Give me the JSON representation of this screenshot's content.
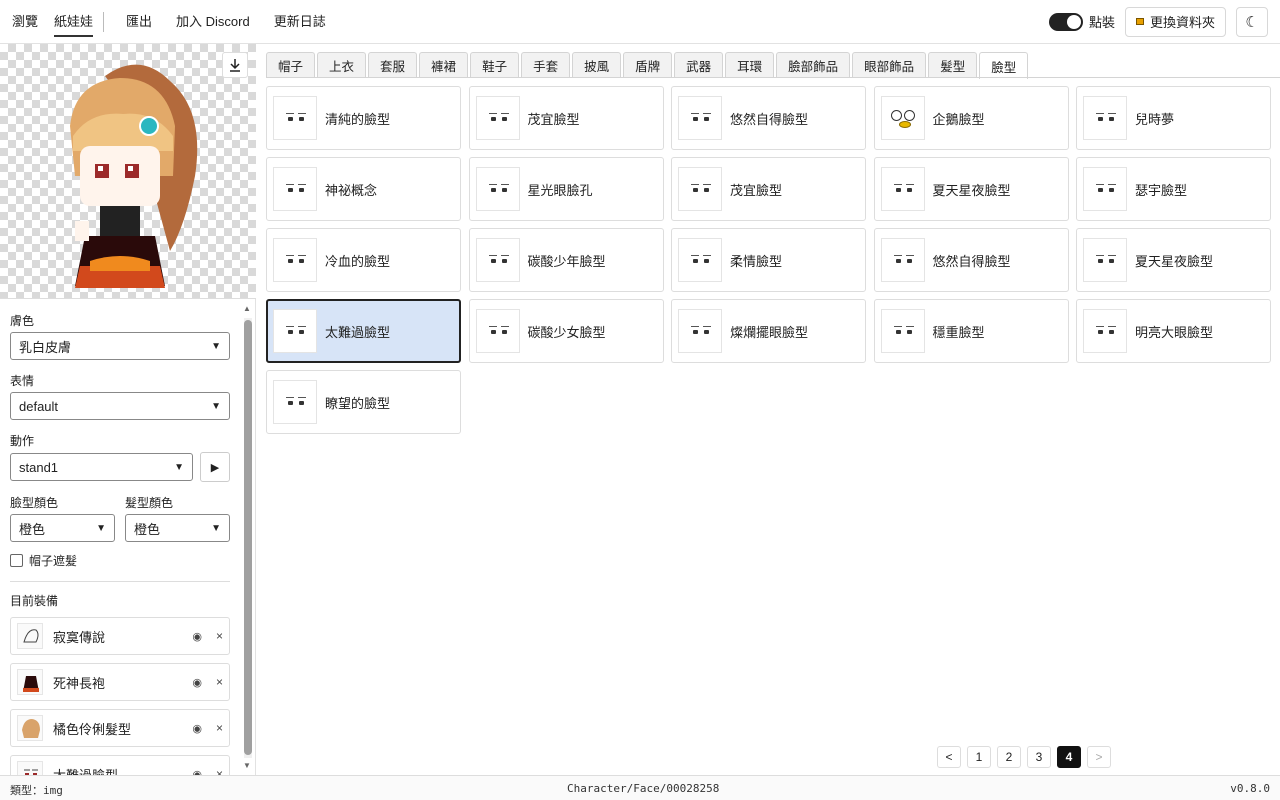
{
  "nav": {
    "browse": "瀏覽",
    "paperdoll": "紙娃娃",
    "export": "匯出",
    "discord": "加入 Discord",
    "changelog": "更新日誌",
    "cash_label": "點裝",
    "change_folder": "更換資料夾",
    "theme_glyph": "☾"
  },
  "settings": {
    "skin_label": "膚色",
    "skin_value": "乳白皮膚",
    "expression_label": "表情",
    "expression_value": "default",
    "action_label": "動作",
    "action_value": "stand1",
    "face_color_label": "臉型顏色",
    "face_color_value": "橙色",
    "hair_color_label": "髮型顏色",
    "hair_color_value": "橙色",
    "hat_hair_label": "帽子遮髮",
    "equipped_title": "目前裝備"
  },
  "equipped": [
    {
      "name": "寂寞傳說"
    },
    {
      "name": "死神長袍"
    },
    {
      "name": "橘色伶俐髮型"
    },
    {
      "name": "太難過臉型"
    }
  ],
  "tabs": [
    "帽子",
    "上衣",
    "套服",
    "褲裙",
    "鞋子",
    "手套",
    "披風",
    "盾牌",
    "武器",
    "耳環",
    "臉部飾品",
    "眼部飾品",
    "髮型",
    "臉型"
  ],
  "active_tab": "臉型",
  "faces": [
    "清純的臉型",
    "茂宜臉型",
    "悠然自得臉型",
    "企鵝臉型",
    "兒時夢",
    "神祕概念",
    "星光眼臉孔",
    "茂宜臉型",
    "夏天星夜臉型",
    "瑟宇臉型",
    "冷血的臉型",
    "碳酸少年臉型",
    "柔情臉型",
    "悠然自得臉型",
    "夏天星夜臉型",
    "太難過臉型",
    "碳酸少女臉型",
    "燦爛擺眼臉型",
    "穩重臉型",
    "明亮大眼臉型",
    "瞭望的臉型"
  ],
  "selected_face_index": 15,
  "pager": {
    "prev": "<",
    "pages": [
      "1",
      "2",
      "3",
      "4"
    ],
    "current": "4",
    "next": ">"
  },
  "status": {
    "type": "類型：img",
    "path": "Character/Face/00028258",
    "version": "v0.8.0"
  },
  "colors": {
    "accent": "#222222",
    "selected_bg": "#d7e4f7"
  }
}
